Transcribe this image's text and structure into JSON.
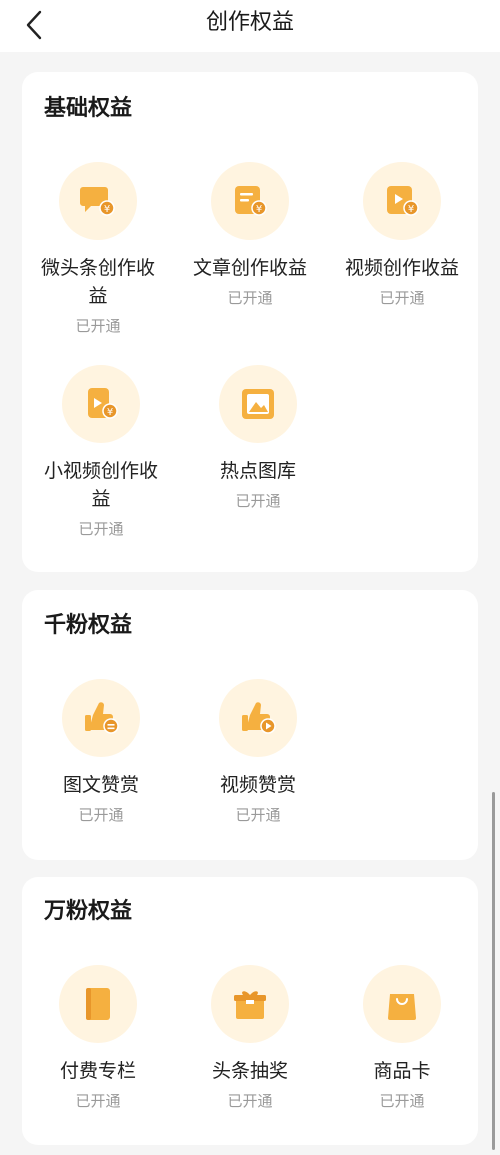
{
  "header": {
    "title": "创作权益"
  },
  "colors": {
    "accent": "#f5b040",
    "accent_dark": "#e8962a",
    "icon_bg": "#fff4e0"
  },
  "sections": [
    {
      "title": "基础权益",
      "items": [
        {
          "name": "微头条创作收益",
          "status": "已开通",
          "icon": "chat-bubble-yuan-icon"
        },
        {
          "name": "文章创作收益",
          "status": "已开通",
          "icon": "article-yuan-icon"
        },
        {
          "name": "视频创作收益",
          "status": "已开通",
          "icon": "video-yuan-icon"
        },
        {
          "name": "小视频创作收益",
          "status": "已开通",
          "icon": "small-video-yuan-icon"
        },
        {
          "name": "热点图库",
          "status": "已开通",
          "icon": "image-gallery-icon"
        }
      ]
    },
    {
      "title": "千粉权益",
      "items": [
        {
          "name": "图文赞赏",
          "status": "已开通",
          "icon": "thumbs-up-text-icon"
        },
        {
          "name": "视频赞赏",
          "status": "已开通",
          "icon": "thumbs-up-video-icon"
        }
      ]
    },
    {
      "title": "万粉权益",
      "items": [
        {
          "name": "付费专栏",
          "status": "已开通",
          "icon": "book-icon"
        },
        {
          "name": "头条抽奖",
          "status": "已开通",
          "icon": "gift-box-icon"
        },
        {
          "name": "商品卡",
          "status": "已开通",
          "icon": "shopping-bag-icon"
        }
      ]
    }
  ]
}
